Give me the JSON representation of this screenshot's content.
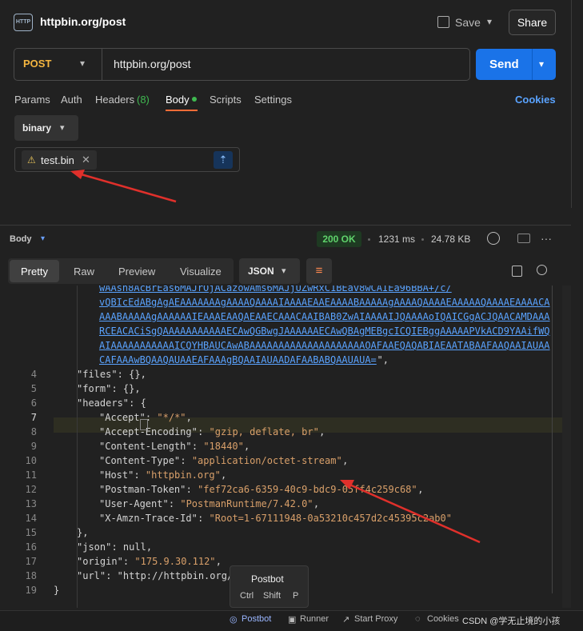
{
  "header": {
    "title": "httpbin.org/post",
    "icon_text": "HTTP",
    "save_label": "Save",
    "share_label": "Share"
  },
  "request": {
    "method": "POST",
    "url": "httpbin.org/post",
    "send_label": "Send"
  },
  "tabs": [
    {
      "label": "Params"
    },
    {
      "label": "Auth"
    },
    {
      "label": "Headers",
      "count": "(8)"
    },
    {
      "label": "Body"
    },
    {
      "label": "Scripts"
    },
    {
      "label": "Settings"
    }
  ],
  "cookies_label": "Cookies",
  "body": {
    "mode": "binary",
    "file_name": "test.bin"
  },
  "response": {
    "label": "Body",
    "status": "200 OK",
    "time": "1231 ms",
    "size": "24.78 KB",
    "views": [
      "Pretty",
      "Raw",
      "Preview",
      "Visualize"
    ],
    "format": "JSON"
  },
  "code": {
    "data_lines": [
      "wAAsh8AcBrEas6MAJrOjACazowAms6MAJjUZwRxC1BEav8wCAIEa96BBA+/c/",
      "vQBIcEdABgAgAEAAAAAAAgAAAAQAAAAIAAAAEAAEAAAABAAAAAgAAAAQAAAAEAAAAAQAAAAEAAAACA",
      "AAABAAAAAgAAAAAAIEAAAEAAQAEAAECAAACAAIBAB0ZwAIAAAAIJQAAAAoIQAICGgACJQAACAMDAAA",
      "RCEACACiSgQAAAAAAAAAAAECAwQGBwgJAAAAAAECAwQBAgMEBgcICQIEBggAAAAAPVkACD9YAAifWQ",
      "AIAAAAAAAAAAAICQYHBAUCAwABAAAAAAAAAAAAAAAAAAAAOAFAAEQAQABIAEAATABAAFAAQAAIAUAA",
      "CAFAAAwBQAAQAUAAEAFAAAgBQAAIAUAADAFAABABQAAUAUA="
    ],
    "lines": [
      {
        "n": "4",
        "key": "\"files\"",
        "val": "{}",
        "tail": ","
      },
      {
        "n": "5",
        "key": "\"form\"",
        "val": "{}",
        "tail": ","
      },
      {
        "n": "6",
        "key": "\"headers\"",
        "val": "{",
        "tail": ""
      },
      {
        "n": "7",
        "key": "\"Accept\"",
        "val": "\"*/*\"",
        "tail": ","
      },
      {
        "n": "8",
        "key": "\"Accept-Encoding\"",
        "val": "\"gzip, deflate, br\"",
        "tail": ","
      },
      {
        "n": "9",
        "key": "\"Content-Length\"",
        "val": "\"18440\"",
        "tail": ","
      },
      {
        "n": "10",
        "key": "\"Content-Type\"",
        "val": "\"application/octet-stream\"",
        "tail": ","
      },
      {
        "n": "11",
        "key": "\"Host\"",
        "val": "\"httpbin.org\"",
        "tail": ","
      },
      {
        "n": "12",
        "key": "\"Postman-Token\"",
        "val": "\"fef72ca6-6359-40c9-bdc9-05ff4c259c68\"",
        "tail": ","
      },
      {
        "n": "13",
        "key": "\"User-Agent\"",
        "val": "\"PostmanRuntime/7.42.0\"",
        "tail": ","
      },
      {
        "n": "14",
        "key": "\"X-Amzn-Trace-Id\"",
        "val": "\"Root=1-67111948-0a53210c457d2c45395c2ab0\"",
        "tail": ""
      },
      {
        "n": "15",
        "key": "",
        "val": "}",
        "tail": ","
      },
      {
        "n": "16",
        "key": "\"json\"",
        "val": "null",
        "tail": ","
      },
      {
        "n": "17",
        "key": "\"origin\"",
        "val": "\"175.9.30.112\"",
        "tail": ","
      },
      {
        "n": "18",
        "key": "\"url\"",
        "val": "\"http://httpbin.org/",
        "tail": ""
      },
      {
        "n": "19",
        "key": "",
        "val": "}",
        "tail": ""
      }
    ]
  },
  "tooltip": {
    "title": "Postbot",
    "keys": [
      "Ctrl",
      "Shift",
      "P"
    ]
  },
  "statusbar": {
    "postbot": "Postbot",
    "runner": "Runner",
    "start_proxy": "Start Proxy",
    "cookies": "Cookies",
    "watermark": "CSDN @学无止境的小孩"
  },
  "colors": {
    "accent_send": "#1a73e8",
    "method_post": "#f5b640",
    "status_ok": "#5fd26b",
    "annotation_arrow": "#e0302b"
  }
}
